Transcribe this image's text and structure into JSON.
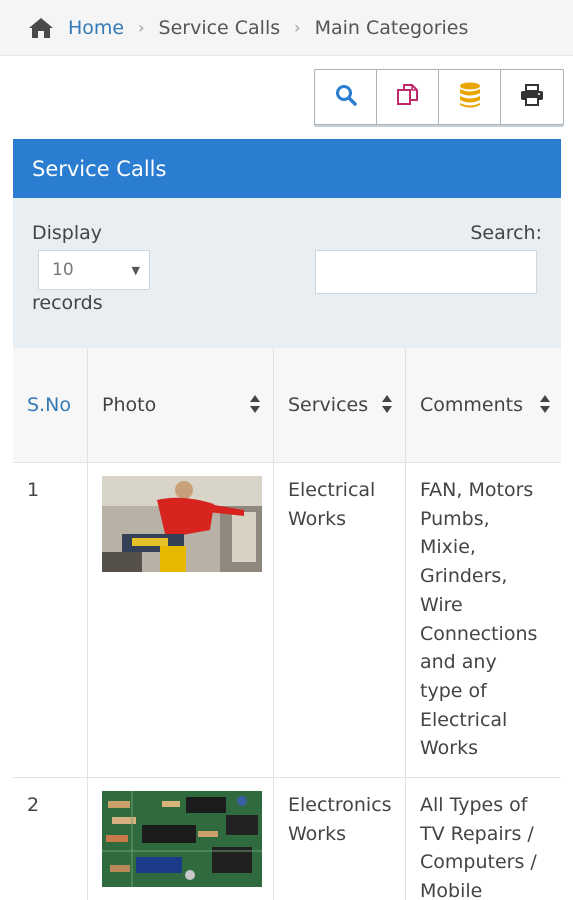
{
  "breadcrumb": {
    "home": "Home",
    "items": [
      "Service Calls",
      "Main Categories"
    ]
  },
  "toolbar": {
    "buttons": [
      "search-icon",
      "copy-icon",
      "database-icon",
      "print-icon"
    ],
    "accent_colors": {
      "search": "#2a7dd0",
      "copy": "#c0286a",
      "database": "#e8a400",
      "print": "#333333"
    }
  },
  "panel": {
    "title": "Service Calls",
    "color": "#2a7dd0"
  },
  "controls": {
    "display_label": "Display",
    "page_size": "10",
    "records_label": "records",
    "search_label": "Search:",
    "search_value": ""
  },
  "table": {
    "headers": {
      "sno": "S.No",
      "photo": "Photo",
      "services": "Services",
      "comments": "Comments"
    },
    "rows": [
      {
        "sno": "1",
        "photo": "electrician-photo",
        "services": [
          "Electrical",
          "Works"
        ],
        "comments": [
          "FAN, Motors",
          "Pumbs,",
          "Mixie,",
          "Grinders,",
          "Wire",
          "Connections",
          "and any",
          "type of",
          "Electrical",
          "Works"
        ]
      },
      {
        "sno": "2",
        "photo": "circuit-board-photo",
        "services": [
          "Electronics",
          "Works"
        ],
        "comments": [
          "All Types of",
          "TV Repairs /",
          "Computers /",
          "Mobile"
        ]
      }
    ]
  }
}
